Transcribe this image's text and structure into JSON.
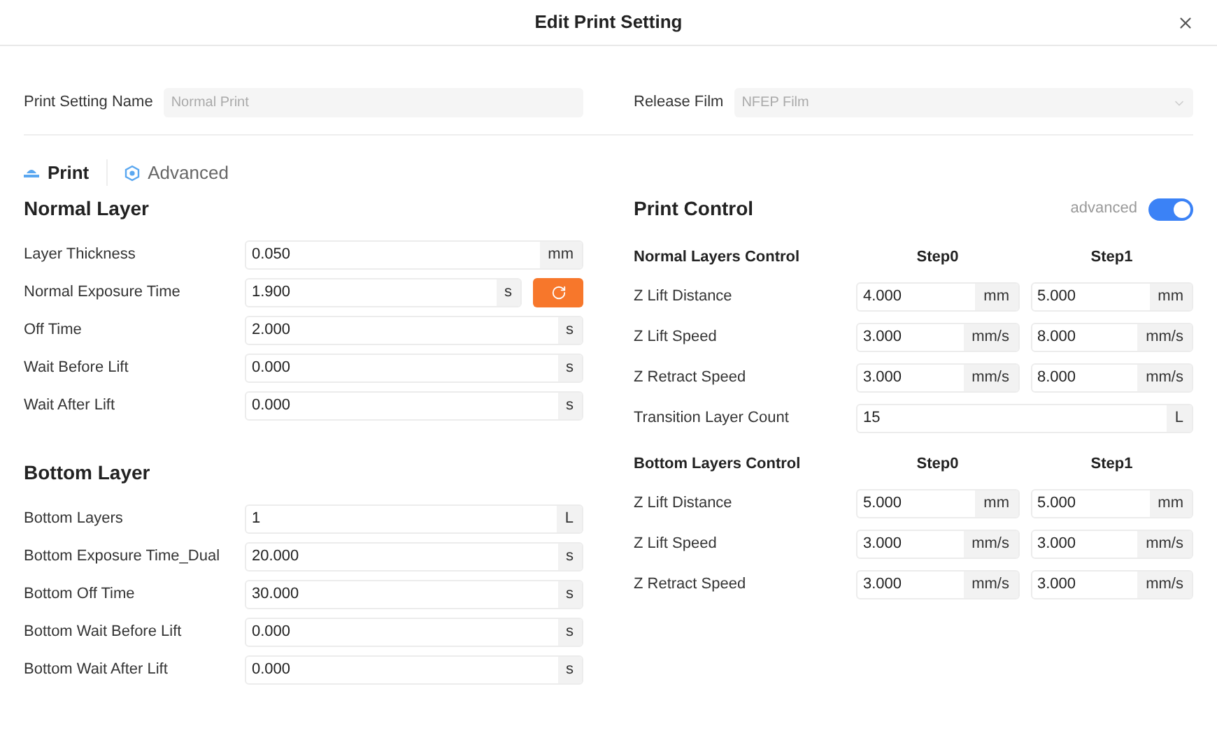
{
  "window": {
    "title": "Edit Print Setting"
  },
  "setting_name": {
    "label": "Print Setting Name",
    "placeholder": "Normal Print",
    "disabled": true
  },
  "release_film": {
    "label": "Release Film",
    "placeholder": "NFEP Film",
    "disabled": true
  },
  "tabs": [
    {
      "label": "Print",
      "kind": "print",
      "selected": true
    },
    {
      "label": "Advanced",
      "kind": "advanced",
      "selected": false
    }
  ],
  "normal_layer": {
    "title": "Normal Layer",
    "rows": [
      {
        "label": "Layer Thickness",
        "value": "0.050",
        "unit": "mm",
        "reset": false
      },
      {
        "label": "Normal Exposure Time",
        "value": "1.900",
        "unit": "s",
        "reset": true
      },
      {
        "label": "Off Time",
        "value": "2.000",
        "unit": "s",
        "reset": false
      },
      {
        "label": "Wait Before Lift",
        "value": "0.000",
        "unit": "s",
        "reset": false
      },
      {
        "label": "Wait After Lift",
        "value": "0.000",
        "unit": "s",
        "reset": false
      }
    ]
  },
  "bottom_layer": {
    "title": "Bottom Layer",
    "rows": [
      {
        "label": "Bottom Layers",
        "value": "1",
        "unit": "L",
        "reset": false
      },
      {
        "label": "Bottom Exposure Time_Dual",
        "value": "20.000",
        "unit": "s",
        "reset": false
      },
      {
        "label": "Bottom Off Time",
        "value": "30.000",
        "unit": "s",
        "reset": false
      },
      {
        "label": "Bottom Wait Before Lift",
        "value": "0.000",
        "unit": "s",
        "reset": false
      },
      {
        "label": "Bottom Wait After Lift",
        "value": "0.000",
        "unit": "s",
        "reset": false
      }
    ]
  },
  "print_control": {
    "title": "Print Control",
    "toggle": {
      "label": "advanced",
      "on": true
    },
    "normal_control": {
      "heading": "Normal Layers Control",
      "columns": [
        "Step0",
        "Step1"
      ],
      "rows": [
        {
          "label": "Z Lift Distance",
          "cells": [
            {
              "value": "4.000",
              "unit": "mm"
            },
            {
              "value": "5.000",
              "unit": "mm"
            }
          ]
        },
        {
          "label": "Z Lift Speed",
          "cells": [
            {
              "value": "3.000",
              "unit": "mm/s"
            },
            {
              "value": "8.000",
              "unit": "mm/s"
            }
          ]
        },
        {
          "label": "Z Retract Speed",
          "cells": [
            {
              "value": "3.000",
              "unit": "mm/s"
            },
            {
              "value": "8.000",
              "unit": "mm/s"
            }
          ]
        }
      ]
    },
    "transition": {
      "label": "Transition Layer Count",
      "value": "15",
      "unit": "L"
    },
    "bottom_control": {
      "heading": "Bottom Layers Control",
      "columns": [
        "Step0",
        "Step1"
      ],
      "rows": [
        {
          "label": "Z Lift Distance",
          "cells": [
            {
              "value": "5.000",
              "unit": "mm"
            },
            {
              "value": "5.000",
              "unit": "mm"
            }
          ]
        },
        {
          "label": "Z Lift Speed",
          "cells": [
            {
              "value": "3.000",
              "unit": "mm/s"
            },
            {
              "value": "3.000",
              "unit": "mm/s"
            }
          ]
        },
        {
          "label": "Z Retract Speed",
          "cells": [
            {
              "value": "3.000",
              "unit": "mm/s"
            },
            {
              "value": "3.000",
              "unit": "mm/s"
            }
          ]
        }
      ]
    }
  }
}
